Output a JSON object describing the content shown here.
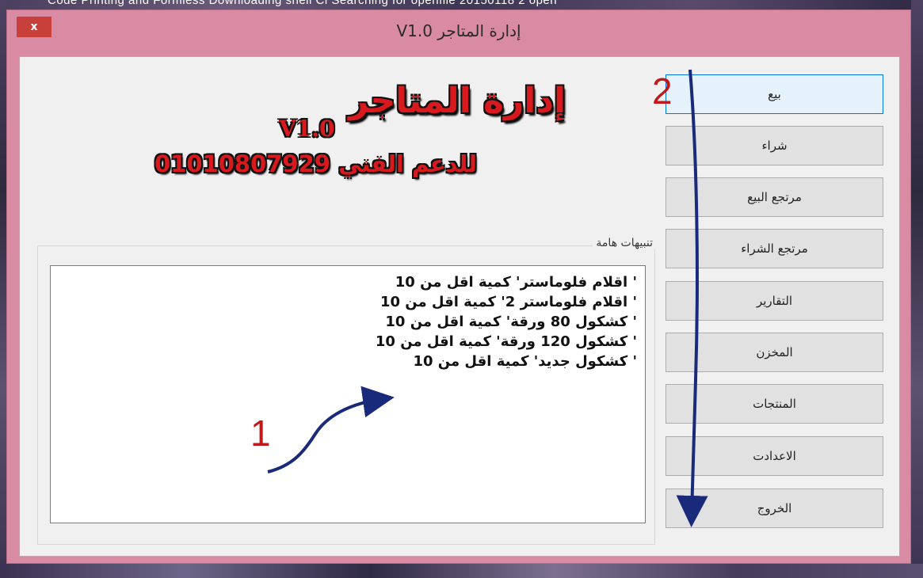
{
  "background": {
    "taskbar_text": "Code    Printing and    Formless    Downloading  shell  Ci    Searching for    openfile    20150118 2    open"
  },
  "window": {
    "title": "إدارة المتاجر V1.0",
    "close_label": "x"
  },
  "header": {
    "app_name": "إدارة المتاجر",
    "version": "V1.0",
    "support_text": "للدعم الفني  01010807929"
  },
  "alerts": {
    "group_title": "تنبيهات هامة",
    "lines": [
      "' اقلام فلوماستر'   كمية اقل من 10",
      "' اقلام فلوماستر 2'  كمية اقل من 10",
      "' كشكول 80 ورقة'  كمية اقل من 10",
      "' كشكول 120 ورقة'  كمية اقل من 10",
      "' كشكول جديد'  كمية اقل من 10"
    ]
  },
  "menu": {
    "buttons": [
      "بيع",
      "شراء",
      "مرتجع البيع",
      "مرتجع الشراء",
      "التقارير",
      "المخزن",
      "المنتجات",
      "الاعدادت",
      "الخروج"
    ]
  },
  "annotations": {
    "label_1": "1",
    "label_2": "2",
    "color": "#c0181b",
    "arrow_color": "#1a2a7a"
  }
}
